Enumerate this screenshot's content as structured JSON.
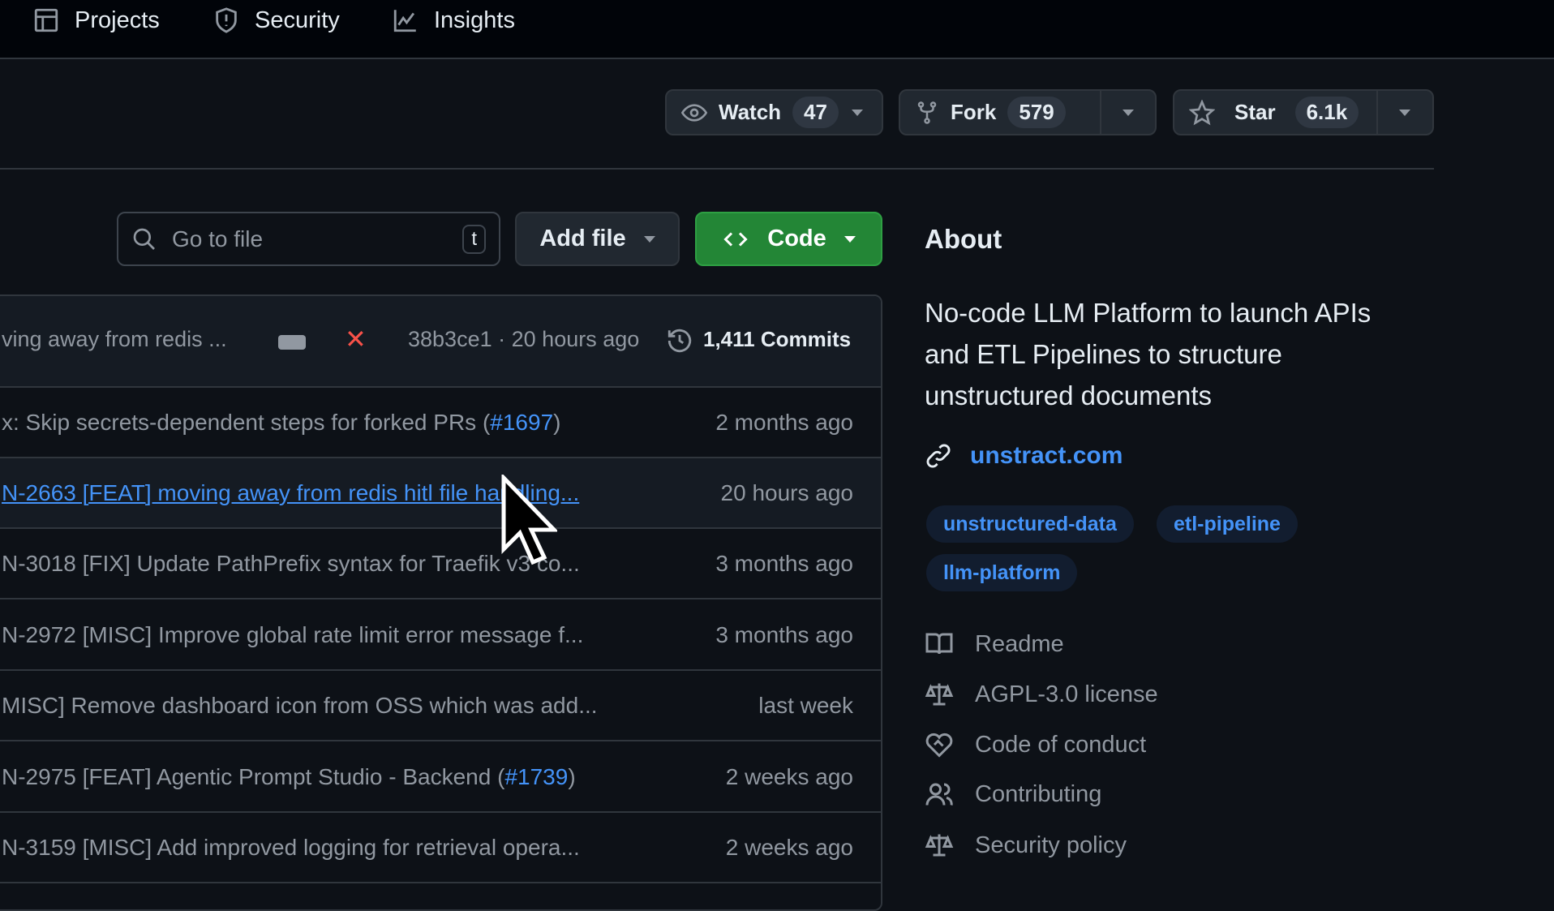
{
  "nav": {
    "items": [
      {
        "label": "Projects",
        "icon": "table-icon"
      },
      {
        "label": "Security",
        "icon": "shield-icon"
      },
      {
        "label": "Insights",
        "icon": "graph-icon"
      }
    ]
  },
  "repo_actions": {
    "watch": {
      "label": "Watch",
      "count": "47"
    },
    "fork": {
      "label": "Fork",
      "count": "579"
    },
    "star": {
      "label": "Star",
      "count": "6.1k"
    }
  },
  "toolbar": {
    "search_placeholder": "Go to file",
    "search_shortcut": "t",
    "add_file": "Add file",
    "code": "Code",
    "code_color": "#238636"
  },
  "latest_commit": {
    "message": "ving away from redis ...",
    "sha": "38b3ce1",
    "time": "20 hours ago",
    "separator": "·",
    "commits": "1,411 Commits",
    "status": "failed"
  },
  "rows": [
    {
      "pre": "x: Skip secrets-dependent steps for forked PRs (",
      "ref": "#1697",
      "post": ")",
      "time": "2 months ago"
    },
    {
      "pre": "N-2663 [FEAT] moving away from redis hitl file handling...",
      "ref": "",
      "post": "",
      "time": "20 hours ago",
      "hovered": true
    },
    {
      "pre": "N-3018 [FIX] Update PathPrefix syntax for Traefik v3 co...",
      "ref": "",
      "post": "",
      "time": "3 months ago"
    },
    {
      "pre": "N-2972 [MISC] Improve global rate limit error message f...",
      "ref": "",
      "post": "",
      "time": "3 months ago"
    },
    {
      "pre": "MISC] Remove dashboard icon from OSS which was add...",
      "ref": "",
      "post": "",
      "time": "last week"
    },
    {
      "pre": "N-2975 [FEAT] Agentic Prompt Studio - Backend (",
      "ref": "#1739",
      "post": ")",
      "time": "2 weeks ago"
    },
    {
      "pre": "N-3159 [MISC] Add improved logging for retrieval opera...",
      "ref": "",
      "post": "",
      "time": "2 weeks ago"
    }
  ],
  "about": {
    "heading": "About",
    "description": [
      "No-code LLM Platform to launch APIs",
      "and ETL Pipelines to structure",
      "unstructured documents"
    ],
    "website": "unstract.com",
    "topics": [
      "unstructured-data",
      "etl-pipeline",
      "llm-platform"
    ],
    "links": [
      {
        "label": "Readme",
        "icon": "book-icon"
      },
      {
        "label": "AGPL-3.0 license",
        "icon": "law-icon"
      },
      {
        "label": "Code of conduct",
        "icon": "code-of-conduct-icon"
      },
      {
        "label": "Contributing",
        "icon": "people-icon"
      },
      {
        "label": "Security policy",
        "icon": "law-icon"
      }
    ]
  }
}
